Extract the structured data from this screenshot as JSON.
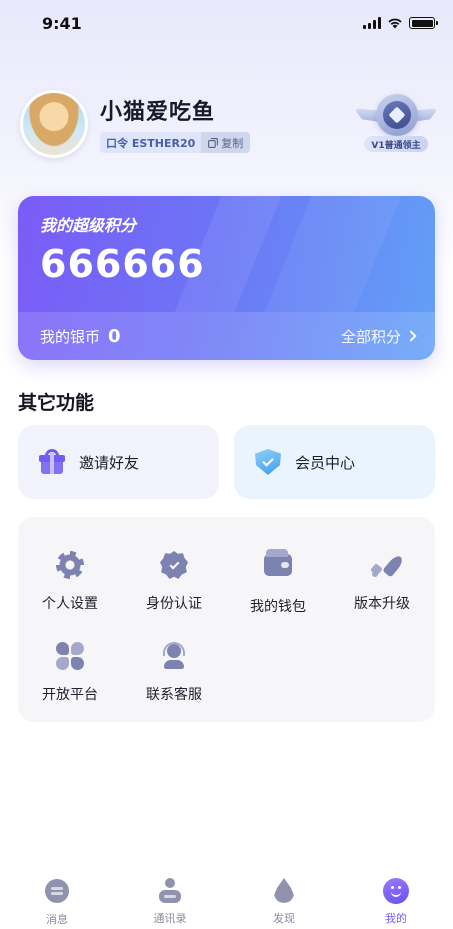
{
  "status_bar": {
    "time": "9:41"
  },
  "profile": {
    "name": "小猫爱吃鱼",
    "invite_code_label": "口令 ESTHER20",
    "copy_label": "复制",
    "level_badge": "V1普通领主"
  },
  "points_card": {
    "title": "我的超级积分",
    "value": "666666",
    "silver_label": "我的银币",
    "silver_value": "0",
    "all_points_label": "全部积分"
  },
  "other_features": {
    "title": "其它功能",
    "invite_friends": "邀请好友",
    "member_center": "会员中心"
  },
  "grid_items": [
    {
      "label": "个人设置",
      "icon": "gear-icon"
    },
    {
      "label": "身份认证",
      "icon": "verified-badge-icon"
    },
    {
      "label": "我的钱包",
      "icon": "wallet-icon"
    },
    {
      "label": "版本升级",
      "icon": "rocket-icon"
    },
    {
      "label": "开放平台",
      "icon": "grid-clover-icon"
    },
    {
      "label": "联系客服",
      "icon": "customer-service-icon"
    }
  ],
  "tab_bar": [
    {
      "label": "消息",
      "icon": "message-icon",
      "active": false
    },
    {
      "label": "通讯录",
      "icon": "contacts-icon",
      "active": false
    },
    {
      "label": "发现",
      "icon": "discover-icon",
      "active": false
    },
    {
      "label": "我的",
      "icon": "mine-icon",
      "active": true
    }
  ],
  "colors": {
    "accent": "#7a5cf0",
    "card_gradient_start": "#7b5bf7",
    "card_gradient_end": "#62a0f7",
    "icon_gray": "#7d83b0"
  }
}
